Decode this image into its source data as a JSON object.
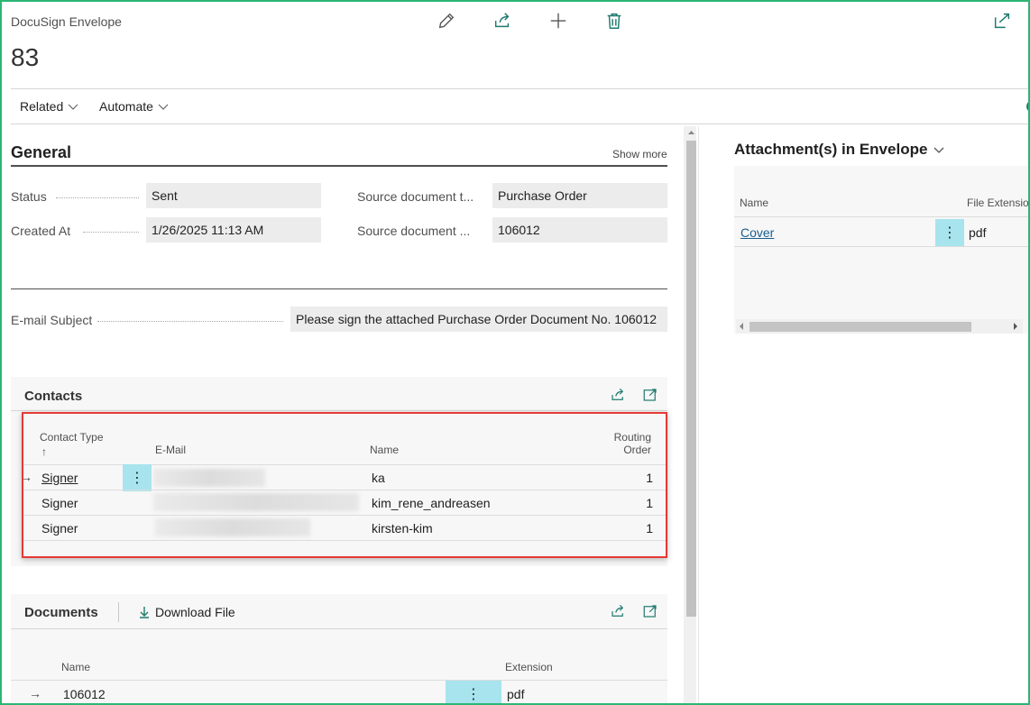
{
  "header": {
    "caption": "DocuSign Envelope",
    "record_no": "83",
    "icons": [
      "edit-icon",
      "share-icon",
      "add-icon",
      "delete-icon",
      "open-in-new-window-icon"
    ]
  },
  "menu": {
    "related": "Related",
    "automate": "Automate"
  },
  "general": {
    "title": "General",
    "show_more": "Show more",
    "status_label": "Status",
    "status_value": "Sent",
    "created_label": "Created At",
    "created_value": "1/26/2025 11:13 AM",
    "source_type_label": "Source document t...",
    "source_type_value": "Purchase Order",
    "source_no_label": "Source document ...",
    "source_no_value": "106012",
    "email_subject_label": "E-mail Subject",
    "email_subject_value": "Please sign the attached Purchase Order Document No. 106012"
  },
  "contacts": {
    "title": "Contacts",
    "columns": {
      "type": "Contact Type",
      "sort": "↑",
      "email": "E-Mail",
      "name": "Name",
      "routing1": "Routing",
      "routing2": "Order"
    },
    "rows": [
      {
        "type": "Signer",
        "name": "ka",
        "order": "1"
      },
      {
        "type": "Signer",
        "name": "kim_rene_andreasen",
        "order": "1"
      },
      {
        "type": "Signer",
        "name": "kirsten-kim",
        "order": "1"
      }
    ]
  },
  "documents": {
    "title": "Documents",
    "download": "Download File",
    "columns": {
      "name": "Name",
      "extension": "Extension"
    },
    "rows": [
      {
        "name": "106012",
        "extension": "pdf"
      }
    ]
  },
  "attachments": {
    "title": "Attachment(s) in Envelope",
    "columns": {
      "name": "Name",
      "extension": "File Extensio"
    },
    "rows": [
      {
        "name": "Cover",
        "extension": "pdf"
      }
    ]
  }
}
